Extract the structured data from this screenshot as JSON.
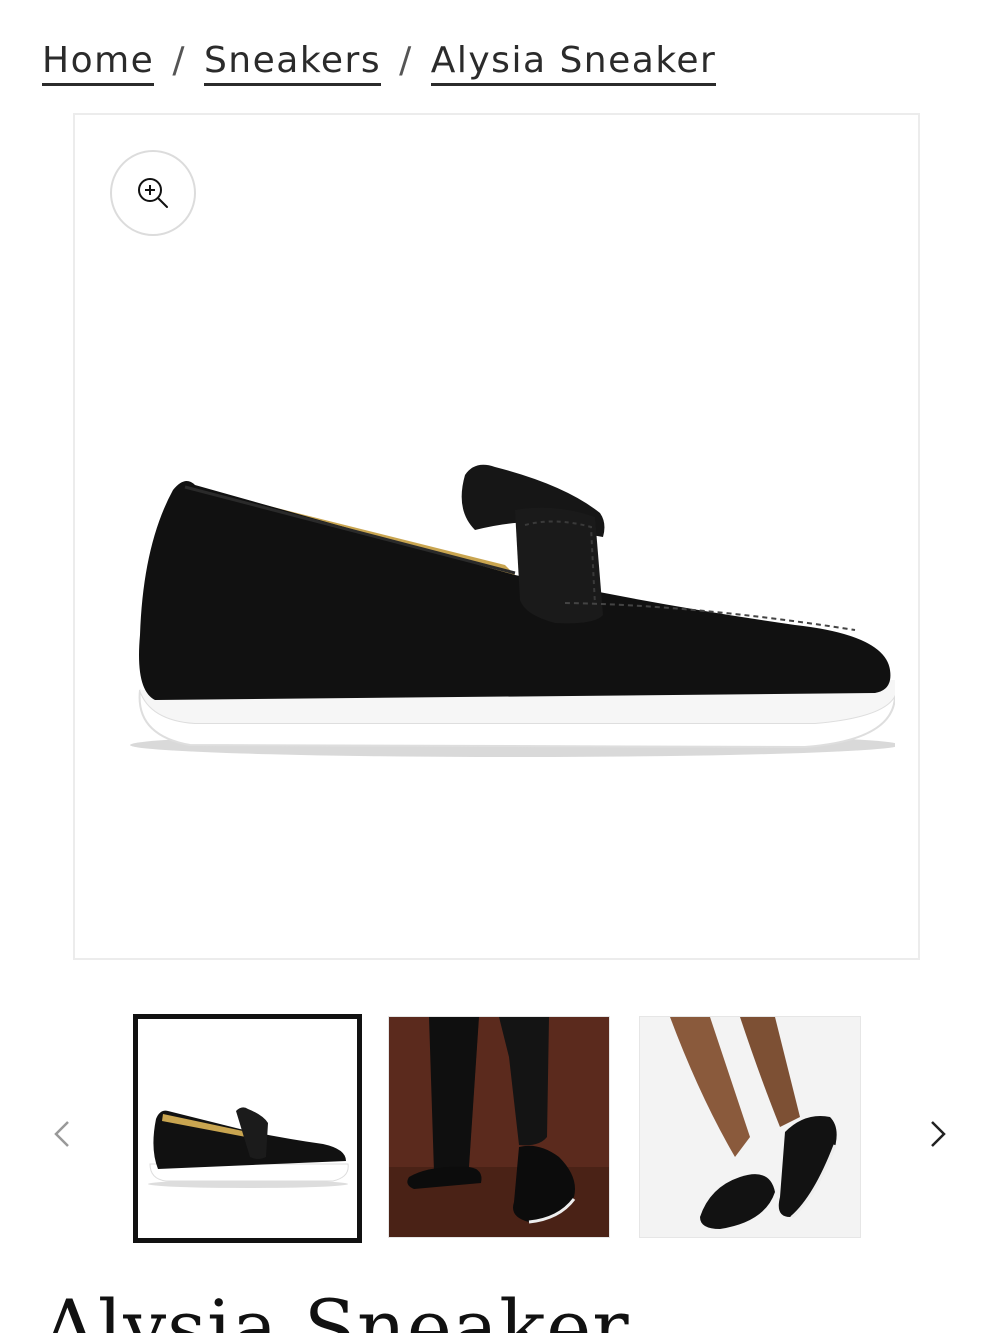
{
  "breadcrumb": {
    "items": [
      {
        "label": "Home"
      },
      {
        "label": "Sneakers"
      },
      {
        "label": "Alysia Sneaker"
      }
    ],
    "separator": "/"
  },
  "gallery": {
    "zoom_icon": "zoom-in-icon",
    "main_image": "black suede loafer sneaker with white sole, side view",
    "prev_icon": "chevron-left-icon",
    "next_icon": "chevron-right-icon",
    "thumbnails": [
      {
        "selected": true,
        "scene": "product side view"
      },
      {
        "selected": false,
        "scene": "worn with black trousers on brown background"
      },
      {
        "selected": false,
        "scene": "worn on bare legs on light background"
      }
    ],
    "colors": {
      "selected_border": "#111111",
      "thumb2_background": "#5b2a1d",
      "thumb3_background": "#f3f3f3"
    }
  },
  "product": {
    "title": "Alysia Sneaker"
  }
}
